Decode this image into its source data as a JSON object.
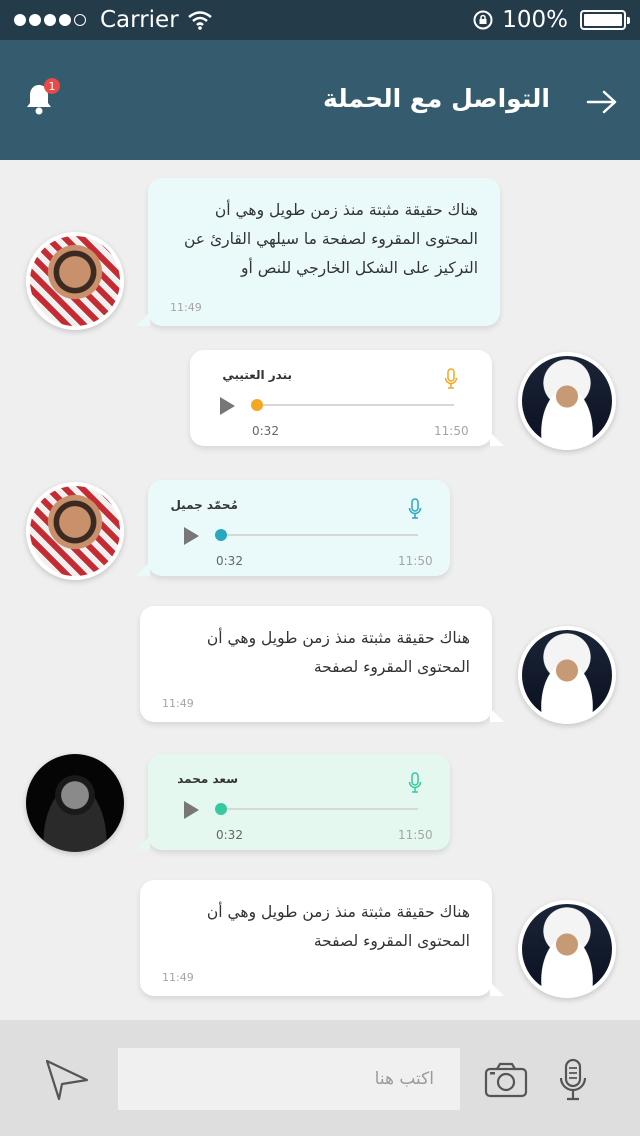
{
  "status": {
    "carrier": "Carrier",
    "battery": "100%"
  },
  "header": {
    "title": "التواصل مع الحملة",
    "notification_count": "1"
  },
  "messages": [
    {
      "text": "هناك حقيقة مثبتة منذ زمن طويل وهي أن المحتوى المقروء لصفحة ما سيلهي القارئ عن التركيز على الشكل الخارجي للنص أو",
      "time": "11:49"
    },
    {
      "name": "بندر العتيبي",
      "duration": "0:32",
      "time": "11:50",
      "progress": 0.0
    },
    {
      "name": "مُحمّد جميل",
      "duration": "0:32",
      "time": "11:50",
      "progress": 0.0
    },
    {
      "text": "هناك حقيقة مثبتة منذ زمن طويل وهي أن المحتوى المقروء لصفحة",
      "time": "11:49"
    },
    {
      "name": "سعد محمد",
      "duration": "0:32",
      "time": "11:50",
      "progress": 0.0
    },
    {
      "text": "هناك حقيقة مثبتة منذ زمن طويل وهي أن المحتوى المقروء لصفحة",
      "time": "11:49"
    }
  ],
  "composer": {
    "placeholder": "اكتب هنا"
  },
  "colors": {
    "header": "#345b6e",
    "status_bar": "#243b49",
    "accent_orange": "#f5a623",
    "accent_teal": "#28a8bf",
    "accent_green": "#35c9a0",
    "badge": "#e84a4a"
  }
}
